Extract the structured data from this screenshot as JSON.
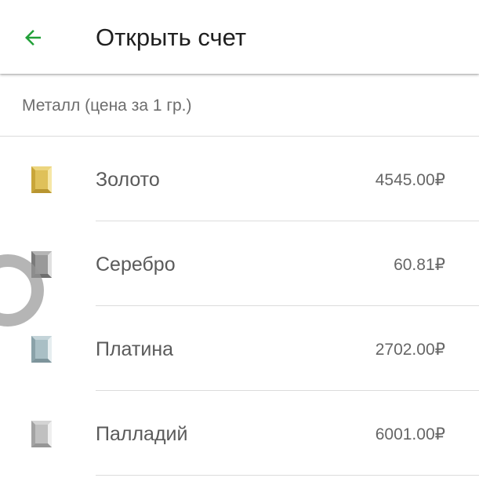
{
  "appbar": {
    "title": "Открыть счет",
    "back_icon": "arrow-left-icon",
    "accent_color": "#21a038"
  },
  "list": {
    "header": "Металл (цена за 1 гр.)",
    "items": [
      {
        "name": "Золото",
        "price": "4545.00₽",
        "icon": "gold-bar-icon",
        "color": "#d9b94a"
      },
      {
        "name": "Серебро",
        "price": "60.81₽",
        "icon": "silver-bar-icon",
        "color": "#8f8f8f"
      },
      {
        "name": "Платина",
        "price": "2702.00₽",
        "icon": "platinum-bar-icon",
        "color": "#9fb6bd"
      },
      {
        "name": "Палладий",
        "price": "6001.00₽",
        "icon": "palladium-bar-icon",
        "color": "#b8b8b8"
      }
    ]
  }
}
